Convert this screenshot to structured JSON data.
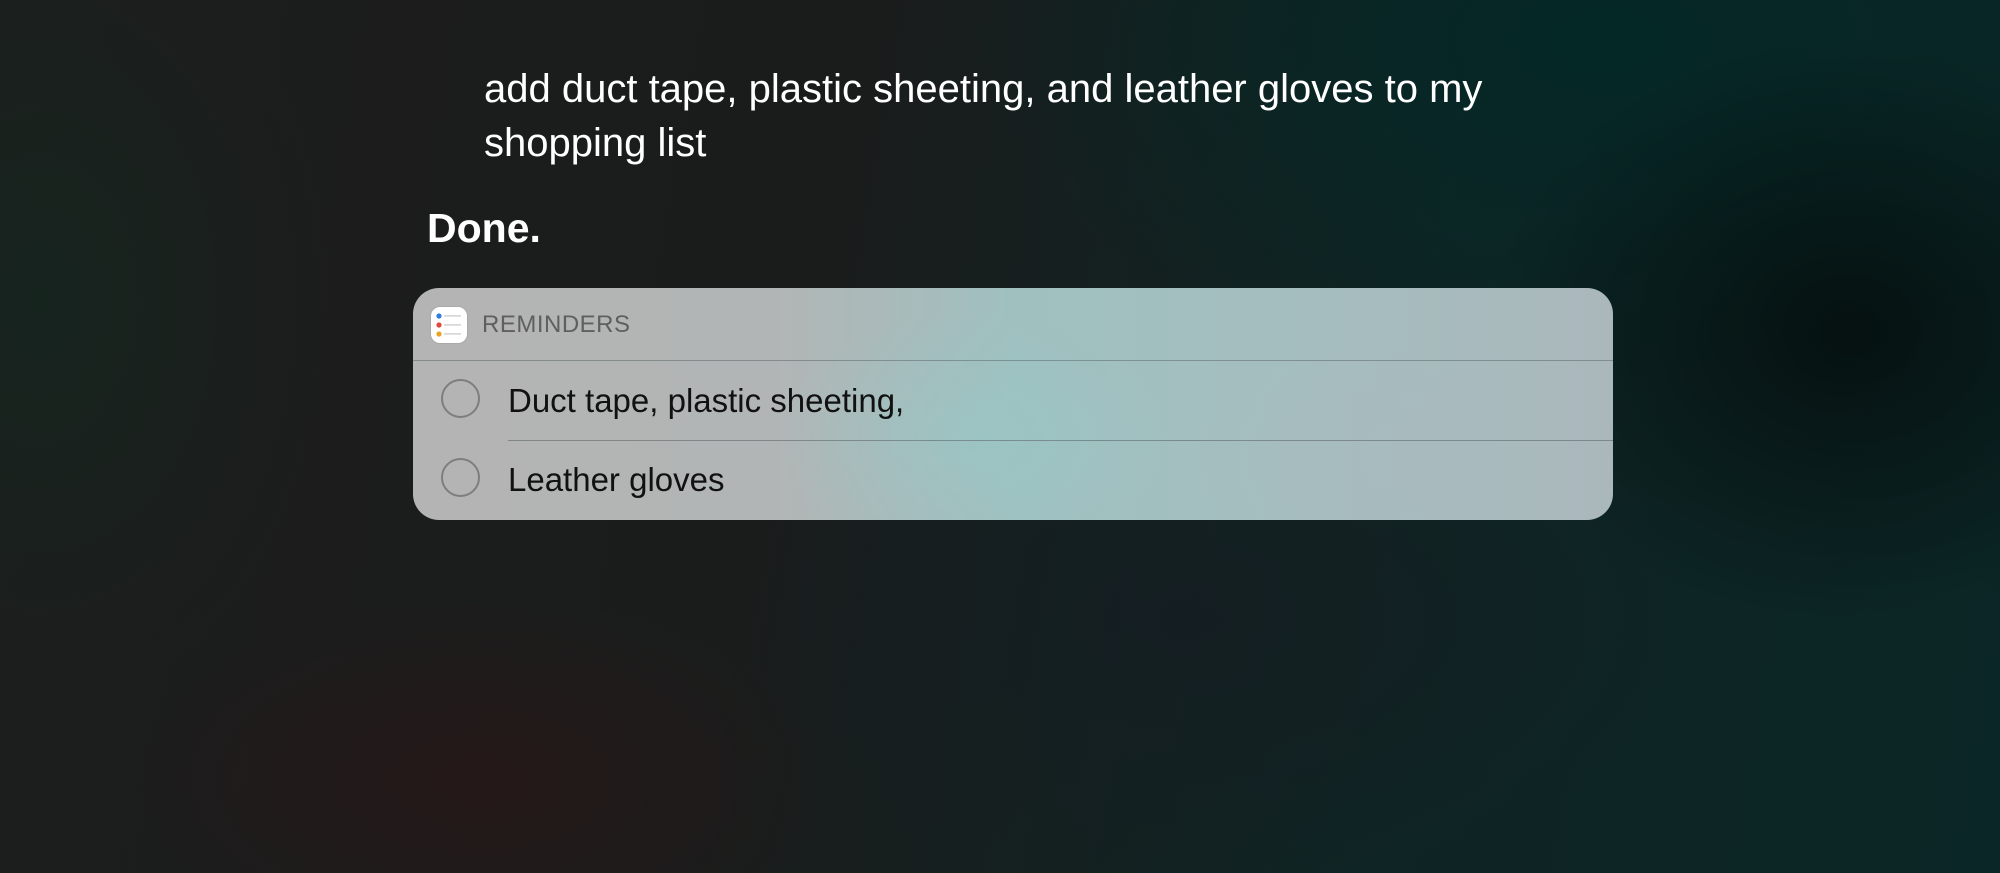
{
  "siri": {
    "query": "add duct tape, plastic sheeting, and leather gloves to my shopping list",
    "response": "Done."
  },
  "card": {
    "app_name": "REMINDERS",
    "app_icon": "reminders-icon",
    "items": [
      {
        "label": "Duct tape, plastic sheeting,",
        "checked": false
      },
      {
        "label": "Leather gloves",
        "checked": false
      }
    ]
  }
}
